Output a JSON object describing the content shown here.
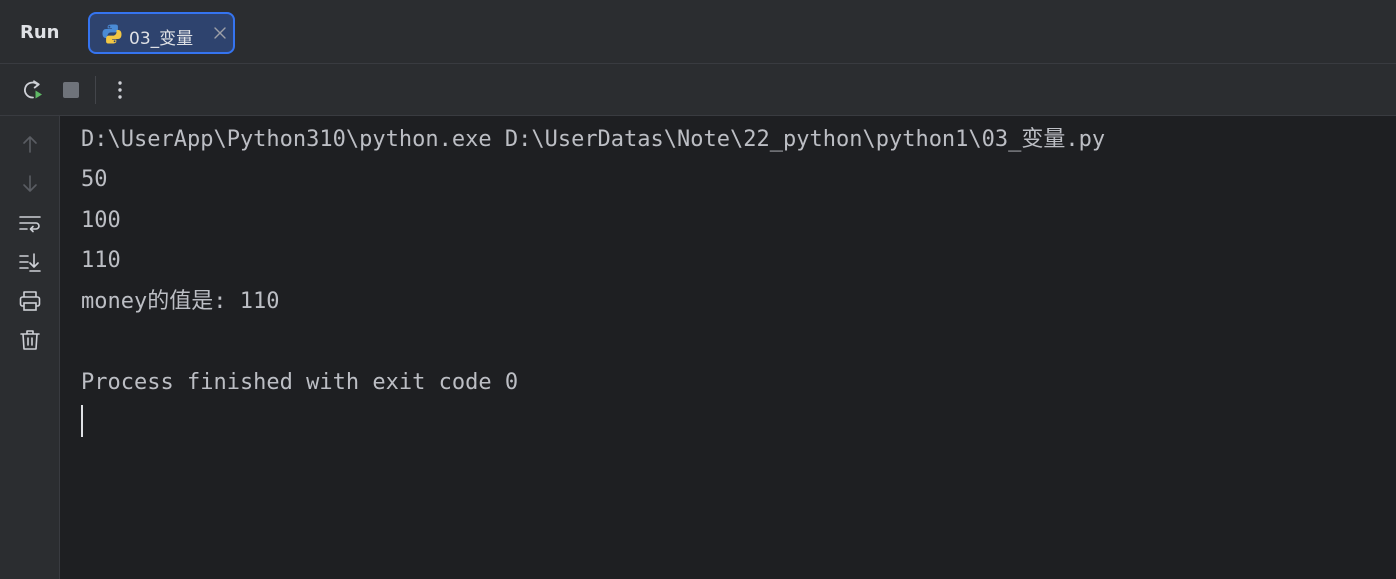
{
  "panel": {
    "title": "Run"
  },
  "tabs": [
    {
      "label": "03_变量",
      "icon": "python-file-icon",
      "active": true
    }
  ],
  "toolbar": {
    "buttons": [
      {
        "name": "rerun-button",
        "icon": "rerun-icon"
      },
      {
        "name": "stop-button",
        "icon": "stop-icon"
      },
      {
        "name": "more-options-button",
        "icon": "more-vertical-icon"
      }
    ]
  },
  "gutter": {
    "buttons": [
      {
        "name": "scroll-up-button",
        "icon": "arrow-up-icon"
      },
      {
        "name": "scroll-down-button",
        "icon": "arrow-down-icon"
      },
      {
        "name": "soft-wrap-button",
        "icon": "soft-wrap-icon"
      },
      {
        "name": "scroll-to-end-button",
        "icon": "scroll-to-end-icon"
      },
      {
        "name": "print-button",
        "icon": "printer-icon"
      },
      {
        "name": "clear-all-button",
        "icon": "trash-icon"
      }
    ]
  },
  "console": {
    "lines": [
      "D:\\UserApp\\Python310\\python.exe D:\\UserDatas\\Note\\22_python\\python1\\03_变量.py",
      "50",
      "100",
      "110",
      "money的值是: 110",
      "",
      "Process finished with exit code 0"
    ]
  },
  "colors": {
    "background": "#1e1f22",
    "panel": "#2b2d30",
    "accent": "#3574f0",
    "text": "#bcbec4",
    "rerun_green": "#5fb865"
  }
}
